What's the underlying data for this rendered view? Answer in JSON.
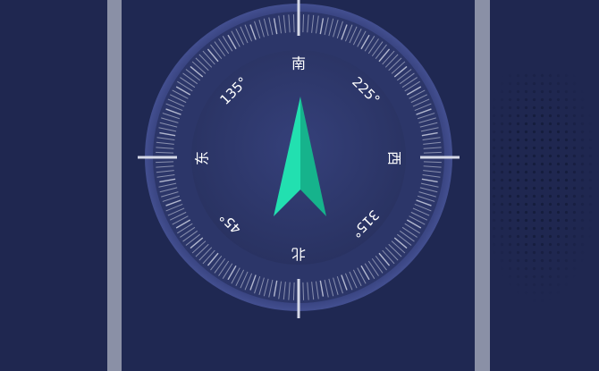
{
  "compass": {
    "labels": {
      "south": "南",
      "deg225": "225°",
      "west": "西",
      "deg315": "315°",
      "north": "北",
      "deg45": "45°",
      "east": "东",
      "deg135": "135°"
    },
    "heading_degrees": 180,
    "colors": {
      "background": "#1f2750",
      "dial_face": "#2b3566",
      "dial_rim": "#3c4784",
      "tick": "#d6d9e8",
      "needle_light": "#22e0b0",
      "needle_dark": "#16b38c",
      "bezel": "#8a90a6"
    }
  }
}
